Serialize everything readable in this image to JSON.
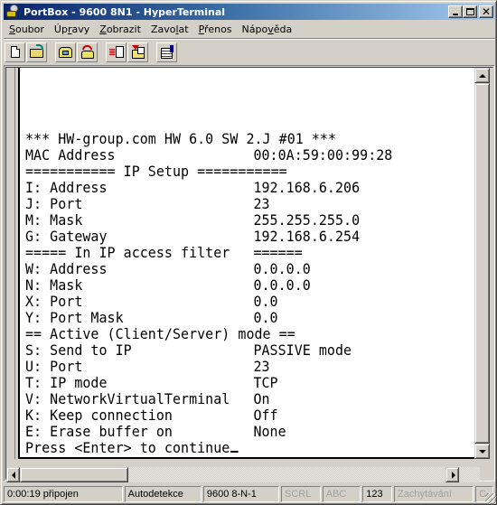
{
  "window": {
    "title": "PortBox - 9600 8N1 - HyperTerminal",
    "icon": "hyperterminal-icon",
    "controls": [
      "minimize",
      "maximize",
      "close"
    ],
    "close_glyph": "✕"
  },
  "menu": {
    "items": [
      {
        "label": "Soubor",
        "accel_index": 0
      },
      {
        "label": "Úpravy",
        "accel_index": 2
      },
      {
        "label": "Zobrazit",
        "accel_index": 0
      },
      {
        "label": "Zavolat",
        "accel_index": 4
      },
      {
        "label": "Přenos",
        "accel_index": 0
      },
      {
        "label": "Nápověda",
        "accel_index": 4
      }
    ]
  },
  "toolbar": {
    "buttons": [
      {
        "name": "new",
        "icon": "new-document-icon"
      },
      {
        "name": "open",
        "icon": "open-folder-icon"
      },
      {
        "name": "call",
        "icon": "phone-call-icon"
      },
      {
        "name": "disconnect",
        "icon": "phone-hangup-icon"
      },
      {
        "name": "send",
        "icon": "send-file-icon"
      },
      {
        "name": "receive",
        "icon": "receive-file-icon"
      },
      {
        "name": "properties",
        "icon": "properties-icon"
      }
    ]
  },
  "terminal": {
    "lines": [
      {
        "text": "",
        "value": ""
      },
      {
        "text": "",
        "value": ""
      },
      {
        "text": "*** HW-group.com HW 6.0 SW 2.J #01 ***",
        "value": ""
      },
      {
        "text": "MAC Address",
        "value": "00:0A:59:00:99:28"
      },
      {
        "text": "=========== IP Setup ===========",
        "value": ""
      },
      {
        "text": "I: Address",
        "value": "192.168.6.206"
      },
      {
        "text": "J: Port",
        "value": "23"
      },
      {
        "text": "M: Mask",
        "value": "255.255.255.0"
      },
      {
        "text": "G: Gateway",
        "value": "192.168.6.254"
      },
      {
        "text": "===== In IP access filter",
        "value": "======"
      },
      {
        "text": "W: Address",
        "value": "0.0.0.0"
      },
      {
        "text": "N: Mask",
        "value": "0.0.0.0"
      },
      {
        "text": "X: Port",
        "value": "0.0"
      },
      {
        "text": "Y: Port Mask",
        "value": "0.0"
      },
      {
        "text": "== Active (Client/Server) mode ==",
        "value": ""
      },
      {
        "text": "S: Send to IP",
        "value": "PASSIVE mode"
      },
      {
        "text": "U: Port",
        "value": "23"
      },
      {
        "text": "T: IP mode",
        "value": "TCP"
      },
      {
        "text": "V: NetworkVirtualTerminal",
        "value": "On"
      },
      {
        "text": "K: Keep connection",
        "value": "Off"
      },
      {
        "text": "E: Erase buffer on",
        "value": "None"
      },
      {
        "text": "Press <Enter> to continue",
        "value": "",
        "cursor": true
      }
    ]
  },
  "statusbar": {
    "cells": [
      {
        "label": "0:00:19 připojen",
        "enabled": true
      },
      {
        "label": "Autodetekce",
        "enabled": true
      },
      {
        "label": "9600 8-N-1",
        "enabled": true
      },
      {
        "label": "SCRL",
        "enabled": false
      },
      {
        "label": "ABC",
        "enabled": false
      },
      {
        "label": "123",
        "enabled": true
      },
      {
        "label": "Zachytávání",
        "enabled": false
      },
      {
        "label": "C",
        "enabled": false
      }
    ]
  },
  "colors": {
    "titlebar_start": "#0a246a",
    "titlebar_end": "#a6caf0",
    "chrome": "#d4d0c8",
    "terminal_bg": "#ffffff",
    "terminal_fg": "#000000"
  }
}
